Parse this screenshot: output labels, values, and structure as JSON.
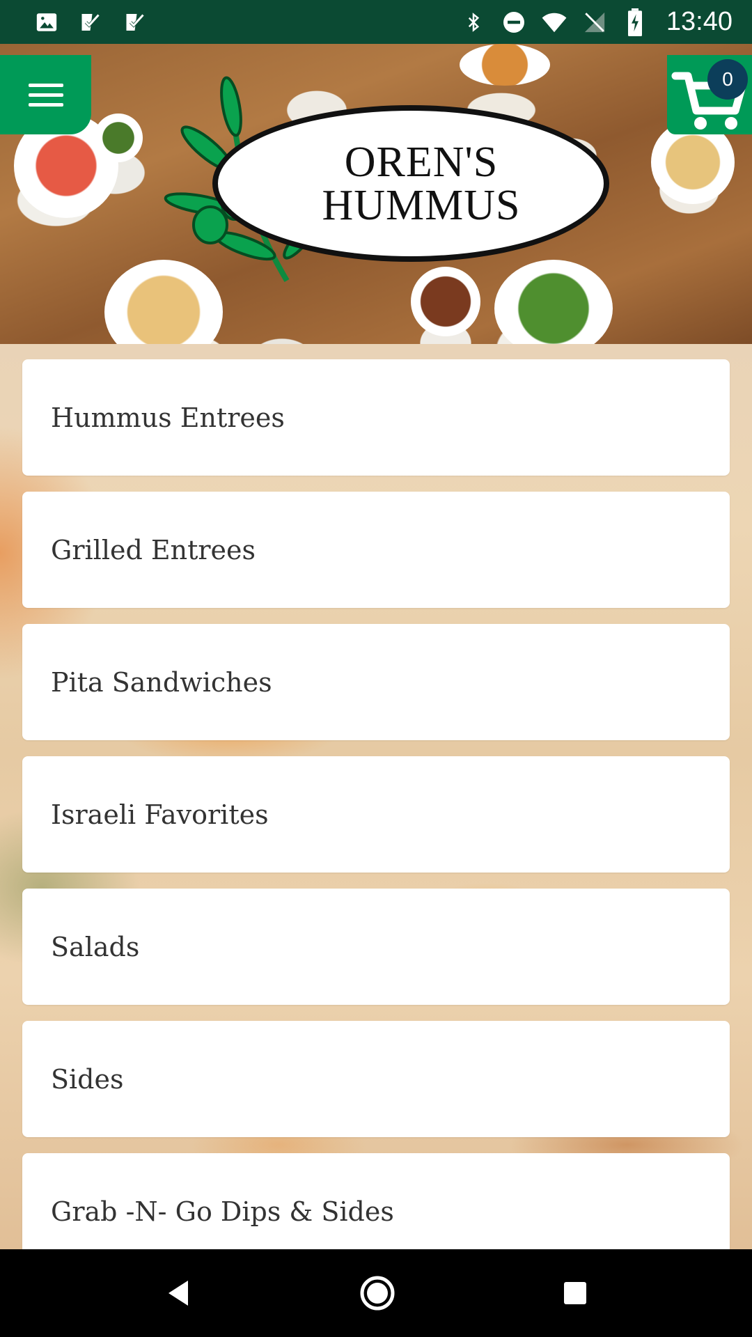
{
  "status_bar": {
    "time": "13:40",
    "left_icons": [
      "image-icon",
      "check-task-icon",
      "check-task-icon"
    ],
    "right_icons": [
      "bluetooth-icon",
      "do-not-disturb-icon",
      "wifi-icon",
      "no-sim-icon",
      "battery-charging-icon"
    ]
  },
  "header": {
    "logo_line1": "OREN'S",
    "logo_line2": "HUMMUS",
    "menu_icon": "hamburger-menu-icon",
    "cart_icon": "shopping-cart-icon",
    "cart_count": "0"
  },
  "menu": {
    "categories": [
      {
        "label": "Hummus Entrees"
      },
      {
        "label": "Grilled Entrees"
      },
      {
        "label": "Pita Sandwiches"
      },
      {
        "label": "Israeli Favorites"
      },
      {
        "label": "Salads"
      },
      {
        "label": "Sides"
      },
      {
        "label": "Grab -N- Go Dips & Sides"
      }
    ]
  },
  "nav_bar": {
    "icons": [
      "back-icon",
      "home-icon",
      "recents-icon"
    ]
  },
  "colors": {
    "brand_green": "#009a57",
    "status_bar": "#0b4a33",
    "cart_badge": "#0c3e5a"
  }
}
